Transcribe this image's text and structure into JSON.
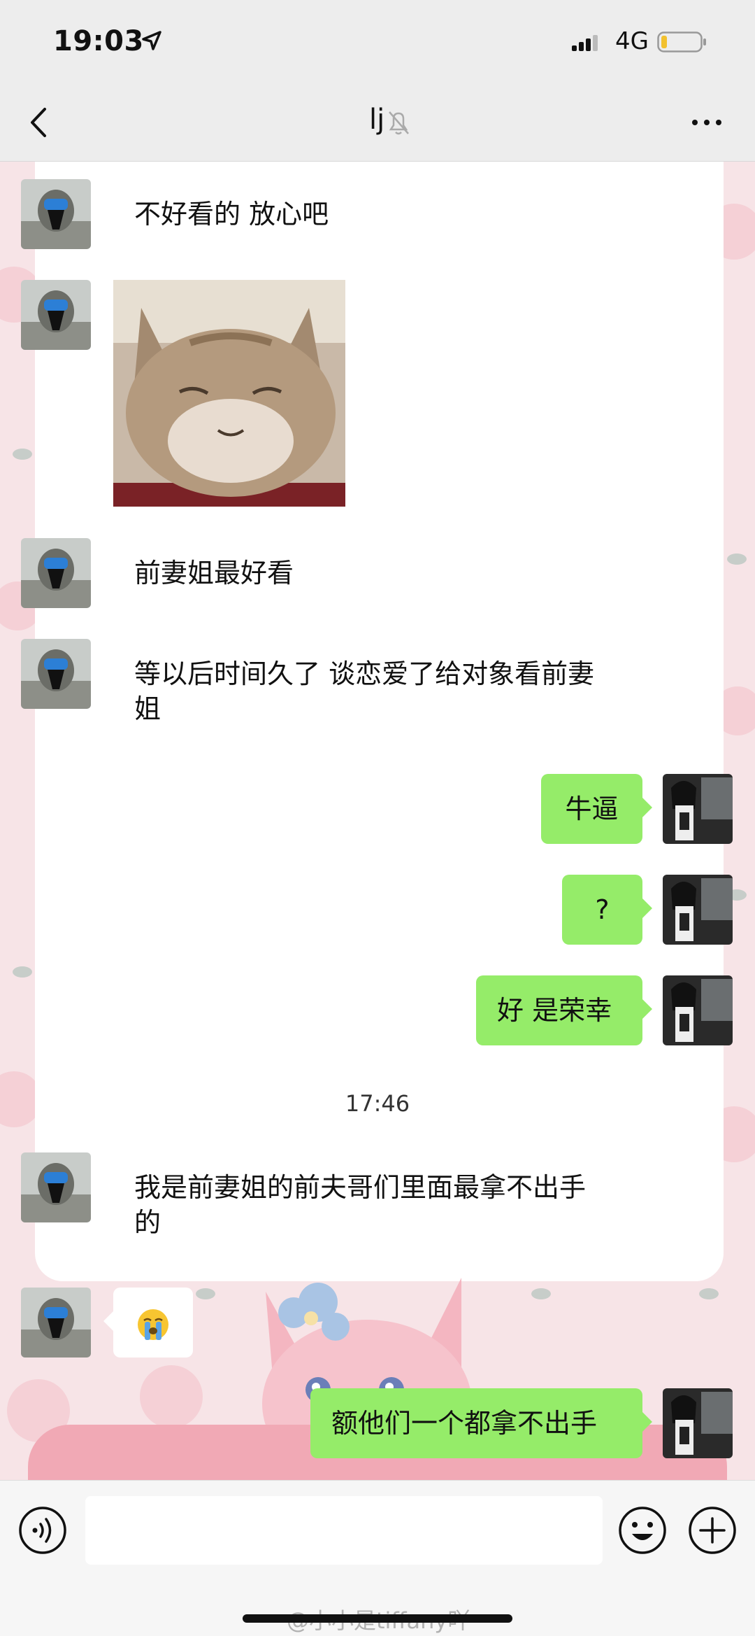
{
  "status_bar": {
    "time": "19:03",
    "network": "4G"
  },
  "nav": {
    "title": "lj"
  },
  "messages": [
    {
      "text": "不好看的 放心吧"
    },
    {
      "text": "前妻姐最好看"
    },
    {
      "text": "等以后时间久了 谈恋爱了给对象看前妻姐"
    },
    {
      "text": "牛逼"
    },
    {
      "text": "?"
    },
    {
      "text": "好 是荣幸"
    },
    {
      "text": "我是前妻姐的前夫哥们里面最拿不出手的"
    },
    {
      "text": "额他们一个都拿不出手"
    }
  ],
  "timestamp": "17:46",
  "watermark": "@小小是tiffany吖",
  "colors": {
    "outgoing_bubble": "#95ec69",
    "incoming_bubble": "#ffffff",
    "bar_bg": "#ededed"
  },
  "icons": [
    "location-arrow-icon",
    "signal-icon",
    "battery-icon",
    "back-arrow-icon",
    "mute-bell-icon",
    "more-icon",
    "voice-icon",
    "emoji-icon",
    "plus-icon",
    "crying-emoji"
  ]
}
